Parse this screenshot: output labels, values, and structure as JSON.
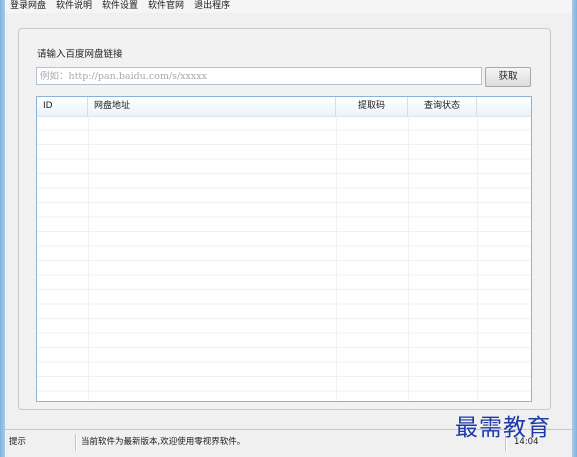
{
  "menu": {
    "items": [
      "登录网盘",
      "软件说明",
      "软件设置",
      "软件官网",
      "退出程序"
    ]
  },
  "main": {
    "prompt": "请输入百度网盘链接",
    "url_input": {
      "value": "",
      "placeholder": "例如：http://pan.baidu.com/s/xxxxx"
    },
    "fetch_button": "获取"
  },
  "table": {
    "columns": [
      "ID",
      "网盘地址",
      "提取码",
      "查询状态",
      ""
    ],
    "rows": []
  },
  "statusbar": {
    "label": "提示",
    "message": "当前软件为最新版本,欢迎使用零视界软件。",
    "time": "14:04"
  },
  "watermark": {
    "text": "最需教育"
  },
  "colors": {
    "frame": "#7fb2dd",
    "table_border": "#8db2d6",
    "watermark": "#1d3aa8"
  }
}
